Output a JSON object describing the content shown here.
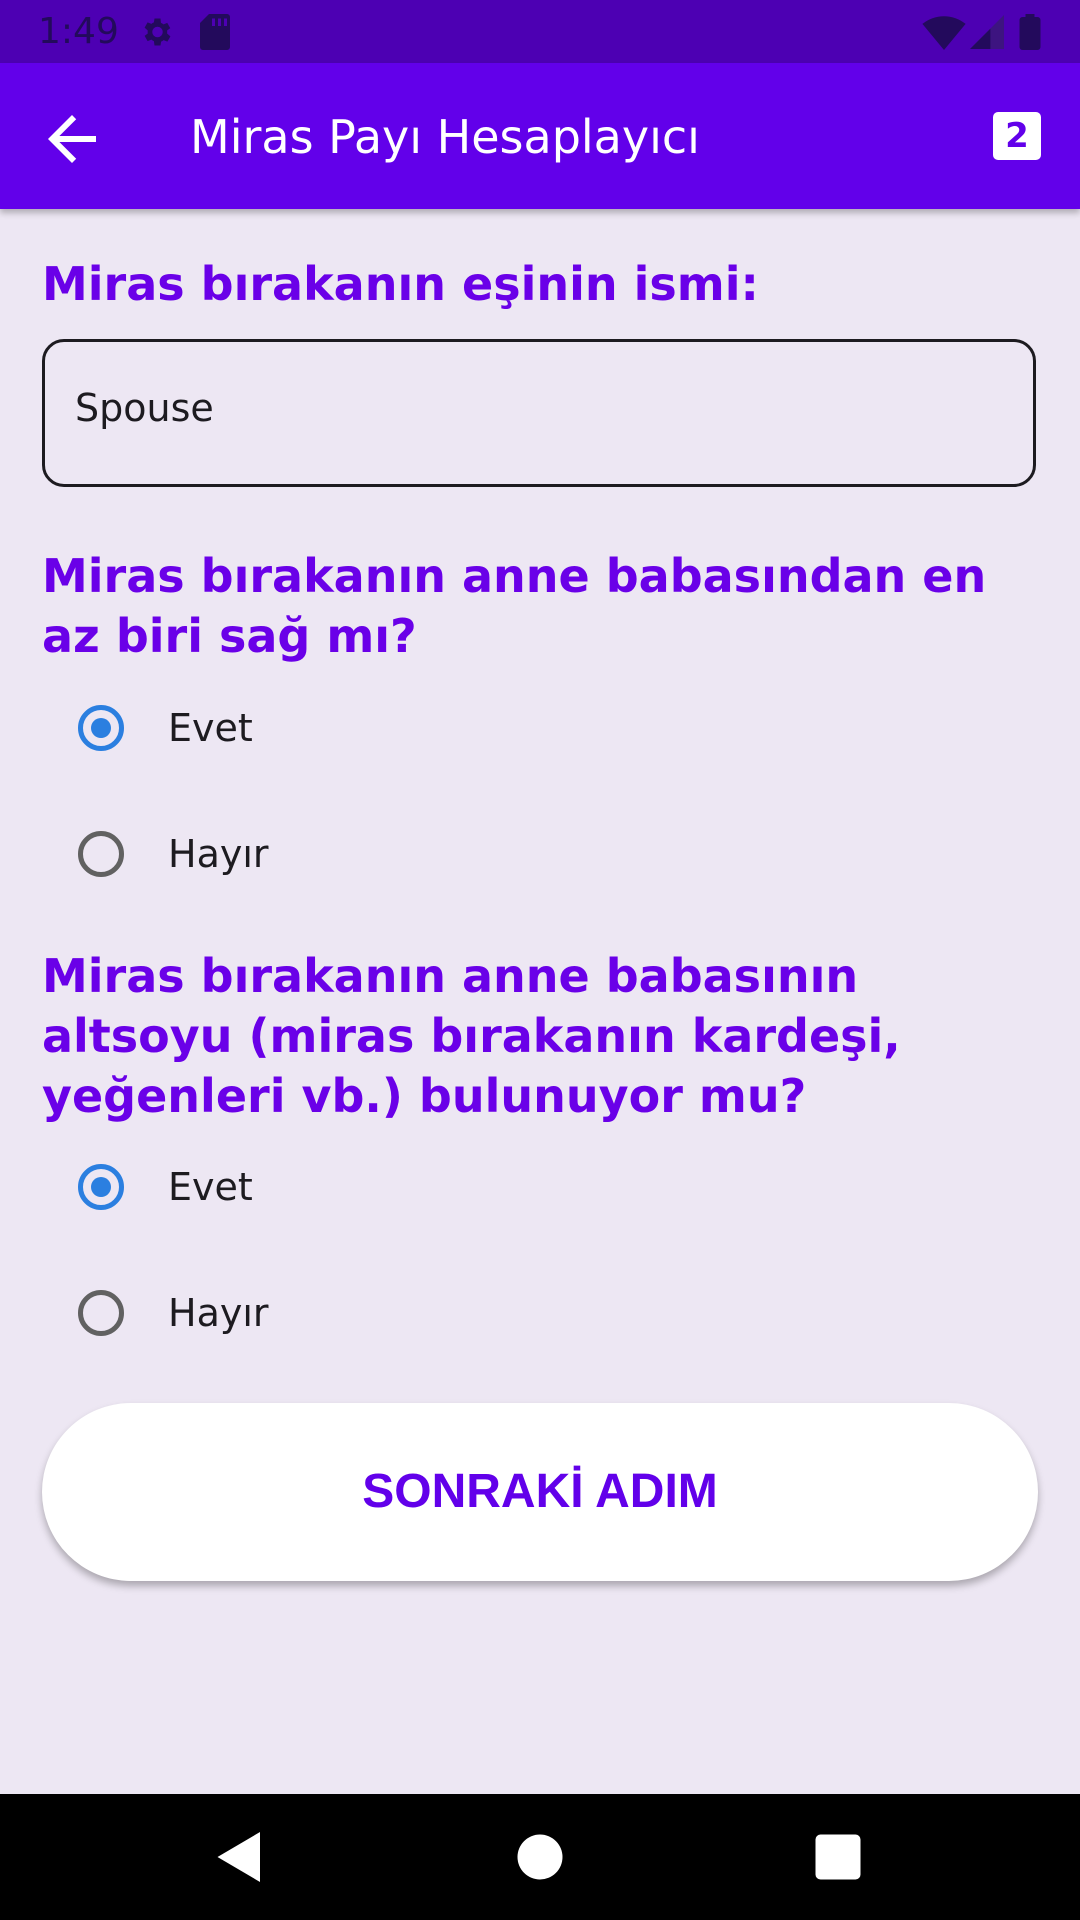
{
  "status_bar": {
    "time": "1:49"
  },
  "app_bar": {
    "title": "Miras Payı Hesaplayıcı",
    "step_badge": "2"
  },
  "spouse_section": {
    "question": "Miras bırakanın eşinin ismi:",
    "input_value": "Spouse"
  },
  "parents_alive": {
    "question": "Miras bırakanın anne babasından en az biri sağ mı?",
    "options": [
      {
        "label": "Evet",
        "selected": true
      },
      {
        "label": "Hayır",
        "selected": false
      }
    ]
  },
  "parents_descendants": {
    "question": "Miras bırakanın anne babasının altsoyu (miras bırakanın kardeşi, yeğenleri vb.) bulunuyor mu?",
    "options": [
      {
        "label": "Evet",
        "selected": true
      },
      {
        "label": "Hayır",
        "selected": false
      }
    ]
  },
  "next_button": {
    "label": "SONRAKİ ADIM"
  },
  "colors": {
    "primary": "#6200ea",
    "status_bar": "#4d00b3",
    "background": "#ede7f3",
    "radio_selected": "#2b7fe0"
  }
}
